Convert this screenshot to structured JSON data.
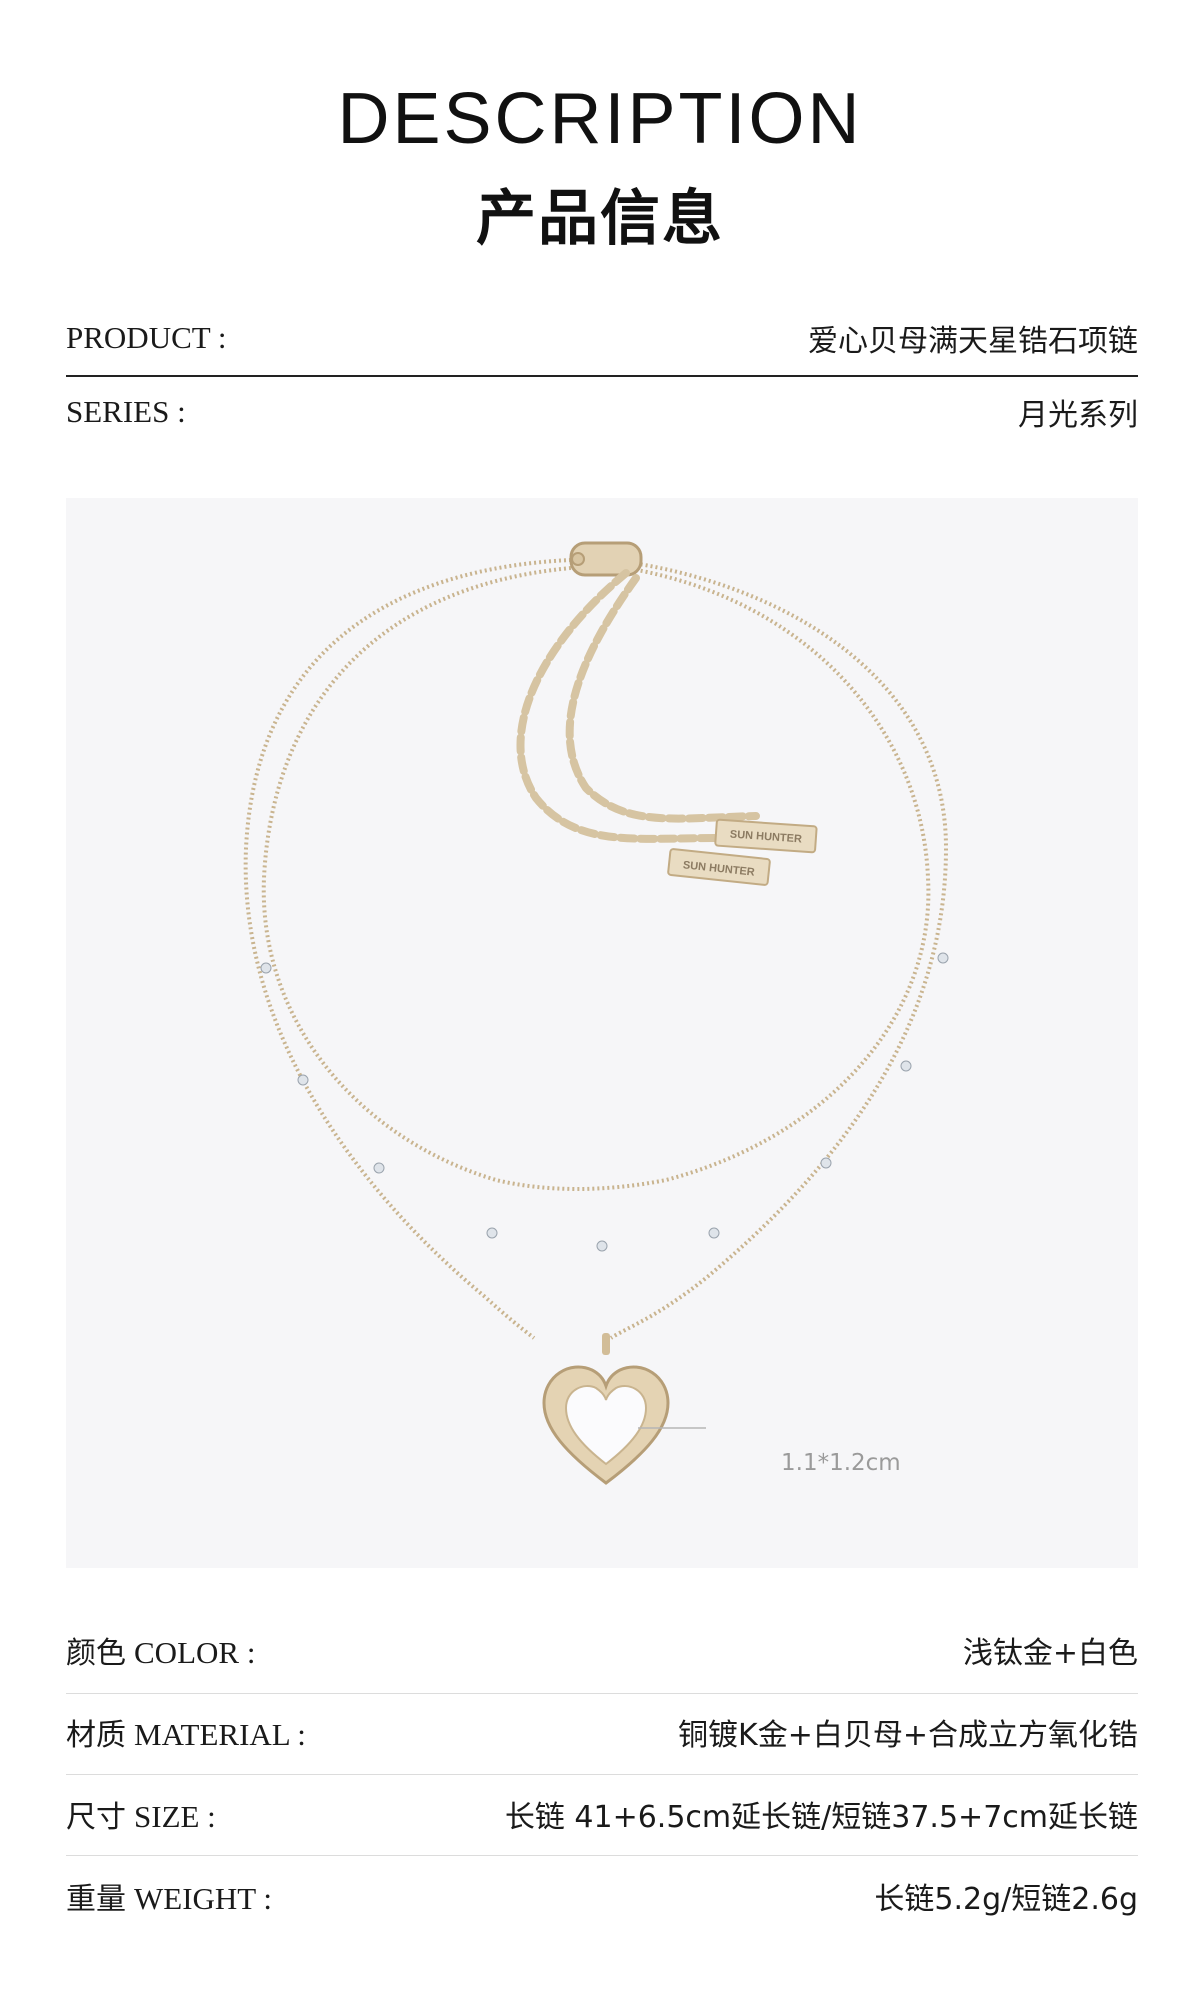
{
  "header": {
    "title_en": "DESCRIPTION",
    "title_zh": "产品信息"
  },
  "product": {
    "label": "PRODUCT :",
    "value": "爱心贝母满天星锆石项链"
  },
  "series": {
    "label": "SERIES :",
    "value": "月光系列"
  },
  "image": {
    "tag_text": "SUN HUNTER",
    "dimension": "1.1*1.2cm",
    "colors": {
      "gold": "#c9b48f",
      "background": "#f6f6f8",
      "pearl": "#ffffff"
    }
  },
  "specs": [
    {
      "label_zh": "颜色",
      "label_en": "COLOR :",
      "value": "浅钛金+白色"
    },
    {
      "label_zh": "材质",
      "label_en": "MATERIAL :",
      "value": "铜镀K金+白贝母+合成立方氧化锆"
    },
    {
      "label_zh": "尺寸",
      "label_en": "SIZE :",
      "value": "长链 41+6.5cm延长链/短链37.5+7cm延长链"
    },
    {
      "label_zh": "重量",
      "label_en": "WEIGHT :",
      "value": "长链5.2g/短链2.6g"
    }
  ]
}
